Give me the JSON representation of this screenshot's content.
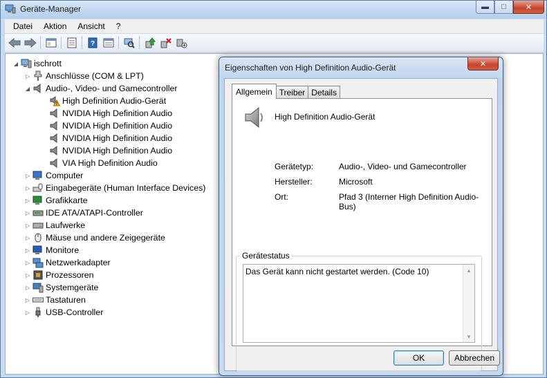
{
  "window": {
    "title": "Geräte-Manager",
    "min": "▬",
    "max": "□",
    "close": "✕"
  },
  "menu": [
    "Datei",
    "Aktion",
    "Ansicht",
    "?"
  ],
  "tree": {
    "root": "ischrott",
    "items": [
      "Anschlüsse (COM & LPT)",
      "Audio-, Video- und Gamecontroller",
      "High Definition Audio-Gerät",
      "NVIDIA High Definition Audio",
      "NVIDIA High Definition Audio",
      "NVIDIA High Definition Audio",
      "NVIDIA High Definition Audio",
      "VIA High Definition Audio",
      "Computer",
      "Eingabegeräte (Human Interface Devices)",
      "Grafikkarte",
      "IDE ATA/ATAPI-Controller",
      "Laufwerke",
      "Mäuse und andere Zeigegeräte",
      "Monitore",
      "Netzwerkadapter",
      "Prozessoren",
      "Systemgeräte",
      "Tastaturen",
      "USB-Controller"
    ]
  },
  "dialog": {
    "title": "Eigenschaften von High Definition Audio-Gerät",
    "close": "✕",
    "tabs": [
      "Allgemein",
      "Treiber",
      "Details"
    ],
    "device_name": "High Definition Audio-Gerät",
    "props": [
      {
        "label": "Gerätetyp:",
        "value": "Audio-, Video- und Gamecontroller"
      },
      {
        "label": "Hersteller:",
        "value": "Microsoft"
      },
      {
        "label": "Ort:",
        "value": "Pfad 3 (Interner High Definition Audio-Bus)"
      }
    ],
    "status_caption": "Gerätestatus",
    "status_text": "Das Gerät kann nicht gestartet werden. (Code 10)",
    "ok_label": "OK",
    "cancel_label": "Abbrechen"
  },
  "colors": {
    "titlebar": "#c3d8ef",
    "warning": "#f5c400",
    "close": "#c4442c"
  }
}
